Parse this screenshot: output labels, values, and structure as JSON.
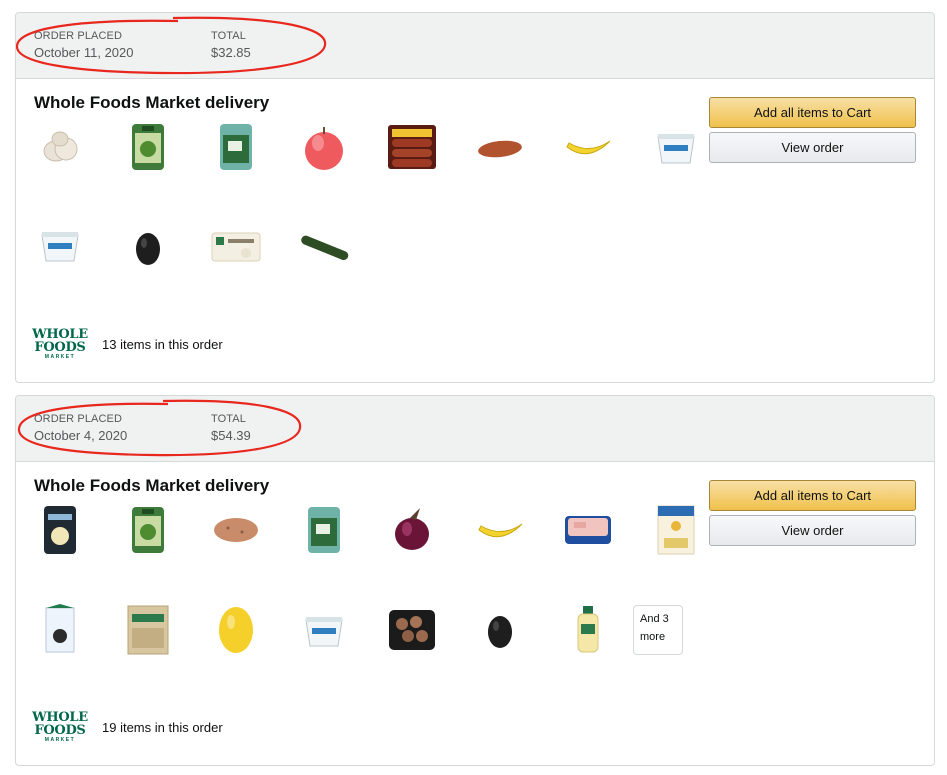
{
  "orders": [
    {
      "placed_label": "ORDER PLACED",
      "placed_date": "October 11, 2020",
      "total_label": "TOTAL",
      "total_value": "$32.85",
      "shipment_title": "Whole Foods Market delivery",
      "add_all_label": "Add all items to Cart",
      "view_order_label": "View order",
      "item_count_text": "13 items in this order",
      "items": [
        "garlic",
        "packaged-greens",
        "packaged-spinach",
        "apple",
        "sausage-pack",
        "sweet-potato",
        "banana",
        "yogurt-cup",
        "yogurt-cup",
        "avocado",
        "cauliflower-rice-bag",
        "cucumber"
      ]
    },
    {
      "placed_label": "ORDER PLACED",
      "placed_date": "October 4, 2020",
      "total_label": "TOTAL",
      "total_value": "$54.39",
      "shipment_title": "Whole Foods Market delivery",
      "add_all_label": "Add all items to Cart",
      "view_order_label": "View order",
      "item_count_text": "19 items in this order",
      "more_text_1": "And 3",
      "more_text_2": "more",
      "items": [
        "cheese-pouch",
        "packaged-greens",
        "potato",
        "packaged-spinach",
        "red-onion",
        "banana",
        "chicken-tray",
        "pasta-box",
        "milk-carton",
        "rice-bag",
        "lemon",
        "yogurt-cup",
        "mushroom-tray",
        "avocado",
        "dressing-bottle"
      ]
    }
  ],
  "brand_logo": {
    "line1": "WHOLE",
    "line2": "FOODS",
    "line3": "MARKET"
  },
  "colors": {
    "annotation_red": "#e8281f",
    "brand_green": "#00674b",
    "button_yellow": "#f0c14b"
  }
}
